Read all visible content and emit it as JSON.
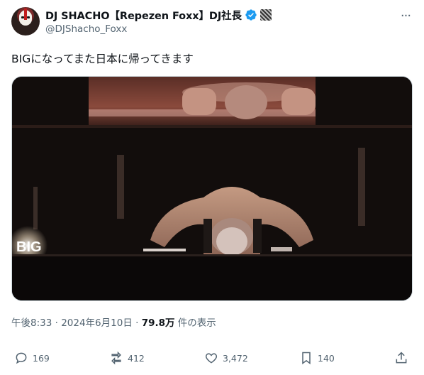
{
  "author": {
    "display_name": "DJ SHACHO【Repezen Foxx】DJ社長",
    "handle": "@DJShacho_Foxx",
    "verified_icon": "verified-badge-icon",
    "avatar": "avatar"
  },
  "tweet": {
    "text": "BIGになってまた日本に帰ってきます",
    "time": "午後8:33 · 2024年6月10日 · ",
    "views_count": "79.8万",
    "views_label": " 件の表示"
  },
  "media": {
    "overlay_text": "BIG"
  },
  "actions": {
    "reply_count": "169",
    "repost_count": "412",
    "like_count": "3,472",
    "bookmark_count": "140"
  },
  "colors": {
    "text_primary": "#0f1419",
    "text_secondary": "#536471",
    "verified_blue": "#1d9bf0"
  }
}
